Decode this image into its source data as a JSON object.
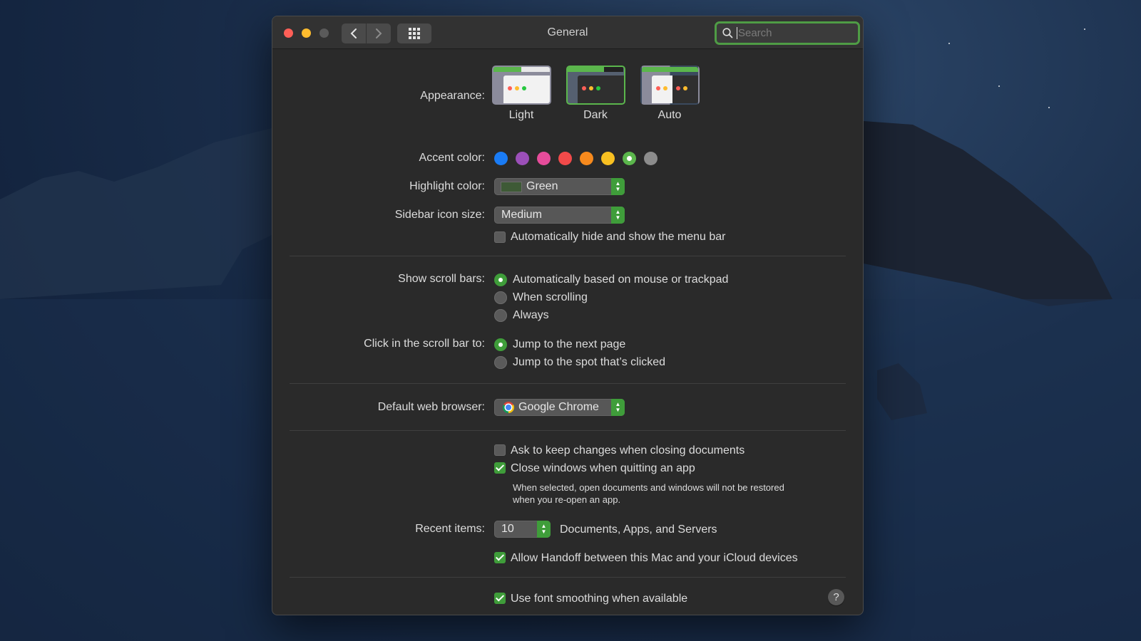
{
  "window": {
    "title": "General",
    "search_placeholder": "Search"
  },
  "appearance": {
    "label": "Appearance:",
    "options": [
      {
        "name": "Light",
        "selected": false
      },
      {
        "name": "Dark",
        "selected": true
      },
      {
        "name": "Auto",
        "selected": false
      }
    ]
  },
  "accent": {
    "label": "Accent color:",
    "colors": [
      "#1a7cf5",
      "#9b4fb8",
      "#e64c9b",
      "#f24a4a",
      "#f78a1d",
      "#f8c021",
      "#5bb64c",
      "#8c8c8c"
    ],
    "selected_index": 6
  },
  "highlight": {
    "label": "Highlight color:",
    "value": "Green"
  },
  "sidebar_icon": {
    "label": "Sidebar icon size:",
    "value": "Medium"
  },
  "menu_bar": {
    "label": "Automatically hide and show the menu bar",
    "checked": false
  },
  "scroll_bars": {
    "label": "Show scroll bars:",
    "options": [
      {
        "label": "Automatically based on mouse or trackpad",
        "selected": true
      },
      {
        "label": "When scrolling",
        "selected": false
      },
      {
        "label": "Always",
        "selected": false
      }
    ]
  },
  "click_scroll": {
    "label": "Click in the scroll bar to:",
    "options": [
      {
        "label": "Jump to the next page",
        "selected": true
      },
      {
        "label": "Jump to the spot that’s clicked",
        "selected": false
      }
    ]
  },
  "browser": {
    "label": "Default web browser:",
    "value": "Google Chrome"
  },
  "documents": {
    "ask_keep": {
      "label": "Ask to keep changes when closing documents",
      "checked": false
    },
    "close_windows": {
      "label": "Close windows when quitting an app",
      "checked": true
    },
    "note_line1": "When selected, open documents and windows will not be restored",
    "note_line2": "when you re-open an app."
  },
  "recent": {
    "label": "Recent items:",
    "value": "10",
    "suffix": "Documents, Apps, and Servers"
  },
  "handoff": {
    "label": "Allow Handoff between this Mac and your iCloud devices",
    "checked": true
  },
  "font_smoothing": {
    "label": "Use font smoothing when available",
    "checked": true
  },
  "help": "?"
}
